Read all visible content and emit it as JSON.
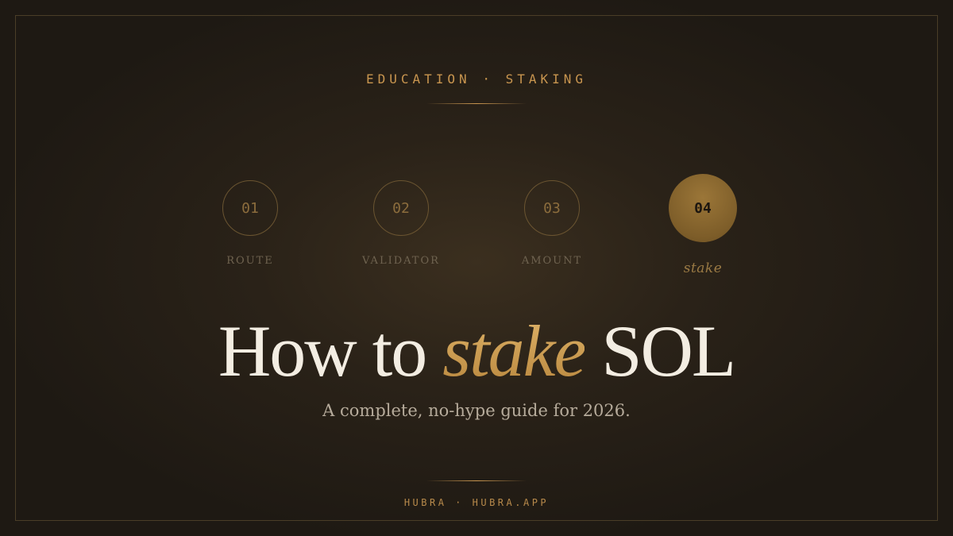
{
  "eyebrow": "EDUCATION · STAKING",
  "steps": [
    {
      "number": "01",
      "label": "ROUTE"
    },
    {
      "number": "02",
      "label": "VALIDATOR"
    },
    {
      "number": "03",
      "label": "AMOUNT"
    },
    {
      "number": "04",
      "label": "stake"
    }
  ],
  "active_step": 4,
  "headline": {
    "before": "How to ",
    "accent": "stake",
    "after": " SOL"
  },
  "subtitle": "A complete, no-hype guide for 2026.",
  "footer": "HUBRA · HUBRA.APP",
  "colors": {
    "accent": "#c8954f",
    "background": "#1f1a14",
    "headline": "#f3ede2"
  }
}
